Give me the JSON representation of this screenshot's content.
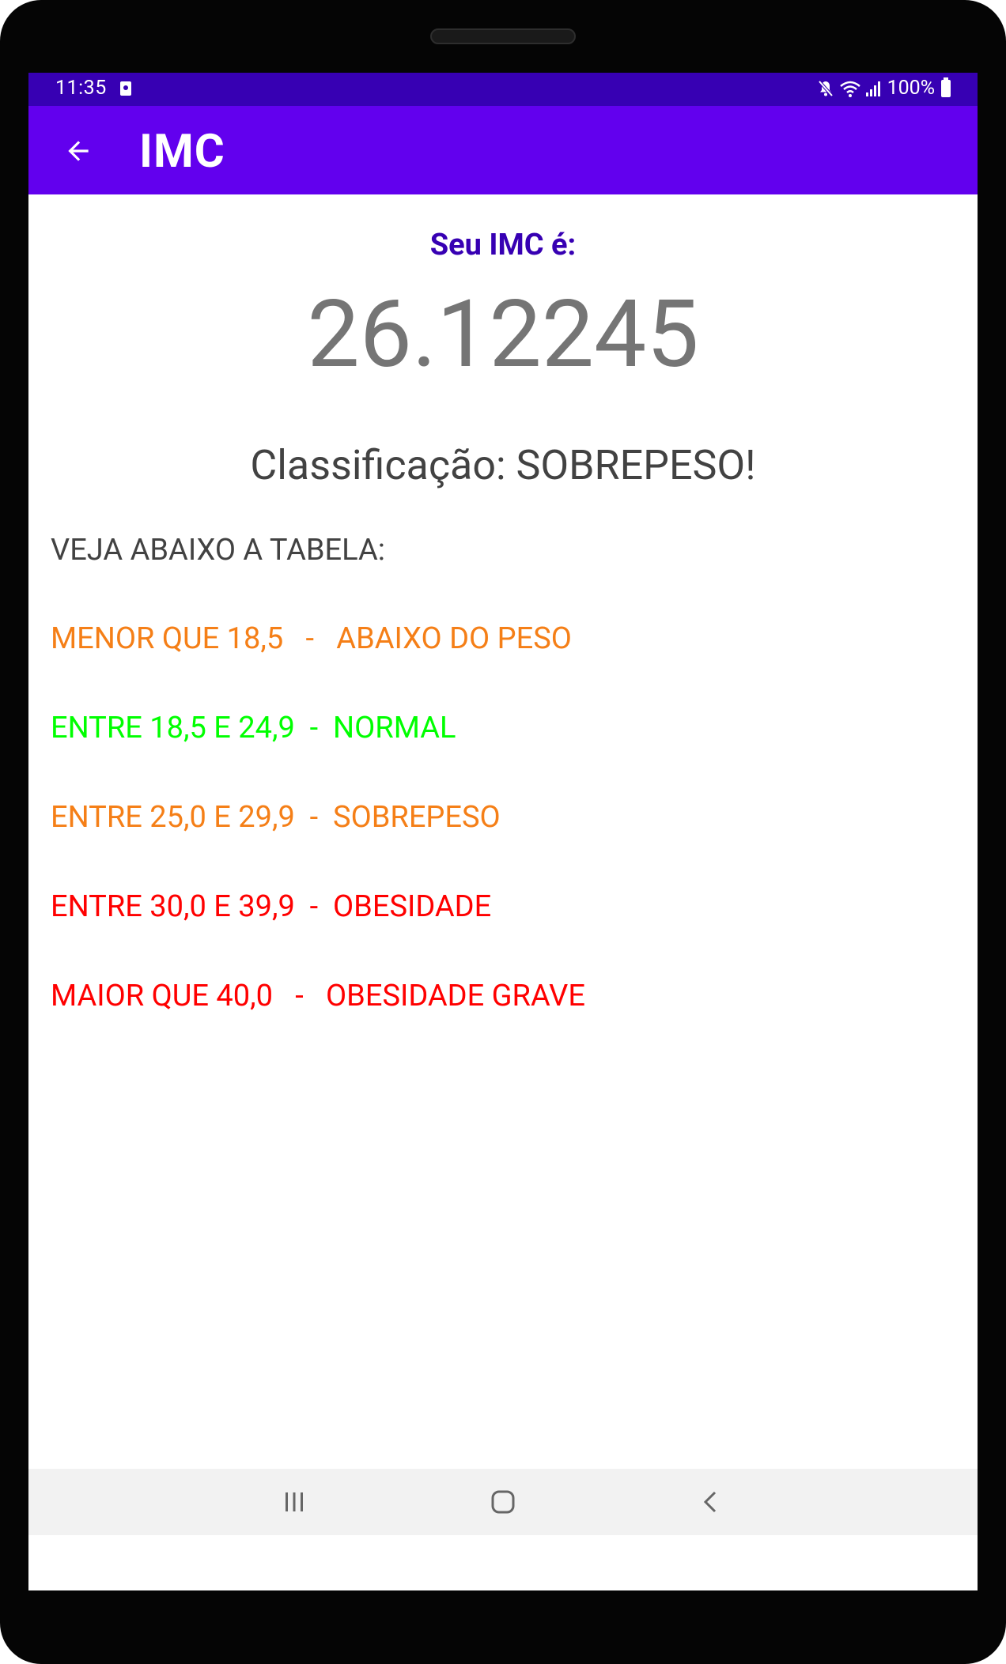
{
  "status_bar": {
    "time": "11:35",
    "battery": "100%"
  },
  "app_bar": {
    "title": "IMC",
    "back_icon": "arrow-back-icon"
  },
  "result": {
    "label": "Seu IMC é:",
    "value": "26.12245",
    "classification": "Classificação: SOBREPESO!"
  },
  "table": {
    "heading": "VEJA ABAIXO A TABELA:",
    "rows": [
      {
        "text": "MENOR QUE 18,5   -   ABAIXO DO PESO",
        "color": "#f57f17"
      },
      {
        "text": "ENTRE 18,5 E 24,9  -  NORMAL",
        "color": "#00ff00"
      },
      {
        "text": "ENTRE 25,0 E 29,9  -  SOBREPESO",
        "color": "#f57f17"
      },
      {
        "text": "ENTRE 30,0 E 39,9  -  OBESIDADE",
        "color": "#ff0000"
      },
      {
        "text": "MAIOR QUE 40,0   -   OBESIDADE GRAVE",
        "color": "#ff0000"
      }
    ]
  },
  "nav_bar": {
    "recents_icon": "recents-icon",
    "home_icon": "home-icon",
    "back_icon": "nav-back-icon"
  },
  "colors": {
    "status_bar": "#3700b3",
    "app_bar": "#6200ee",
    "imc_label": "#3700b3"
  }
}
